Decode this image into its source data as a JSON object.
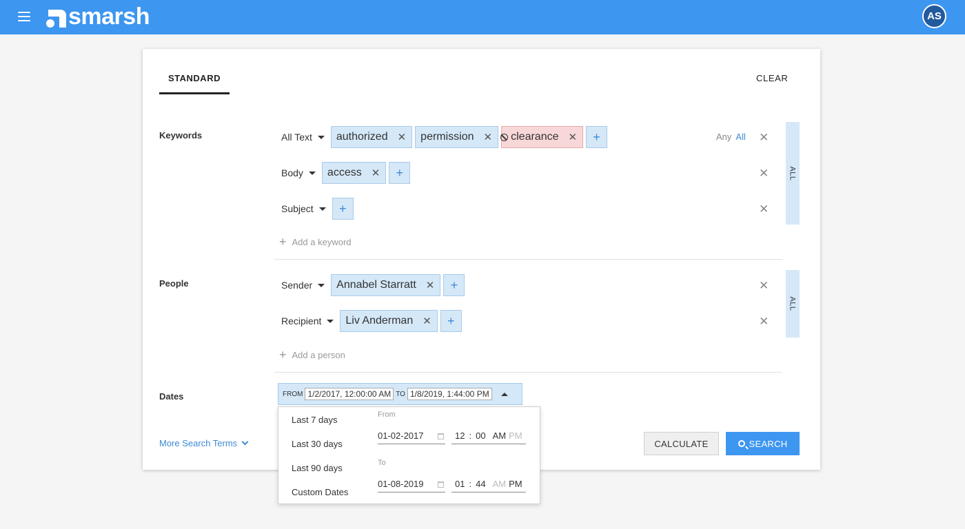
{
  "header": {
    "logo_text": "smarsh",
    "avatar_initials": "AS",
    "brand_color": "#3d96f0"
  },
  "tabs": {
    "standard": "STANDARD",
    "clear": "CLEAR"
  },
  "keywords": {
    "label": "Keywords",
    "rows": [
      {
        "field": "All Text",
        "terms": [
          "authorized",
          "permission"
        ],
        "excluded_terms": [
          "clearance"
        ]
      },
      {
        "field": "Body",
        "terms": [
          "access"
        ]
      },
      {
        "field": "Subject",
        "terms": []
      }
    ],
    "match_any": "Any",
    "match_all": "All",
    "toggle_label": "ALL",
    "add_label": "Add a keyword"
  },
  "people": {
    "label": "People",
    "rows": [
      {
        "field": "Sender",
        "terms": [
          "Annabel Starratt"
        ]
      },
      {
        "field": "Recipient",
        "terms": [
          "Liv Anderman"
        ]
      }
    ],
    "toggle_label": "ALL",
    "add_label": "Add a person"
  },
  "dates": {
    "label": "Dates",
    "from_label": "FROM",
    "from_value": "1/2/2017, 12:00:00 AM",
    "to_label": "TO",
    "to_value": "1/8/2019, 1:44:00 PM",
    "presets": [
      "Last 7 days",
      "Last 30 days",
      "Last 90 days",
      "Custom Dates"
    ],
    "picker": {
      "from_label": "From",
      "from_date": "01-02-2017",
      "from_hour": "12",
      "from_minute": "00",
      "to_label": "To",
      "to_date": "01-08-2019",
      "to_hour": "01",
      "to_minute": "44",
      "am": "AM",
      "pm": "PM"
    }
  },
  "footer": {
    "more_terms": "More Search Terms",
    "calculate": "CALCULATE",
    "search": "SEARCH"
  }
}
